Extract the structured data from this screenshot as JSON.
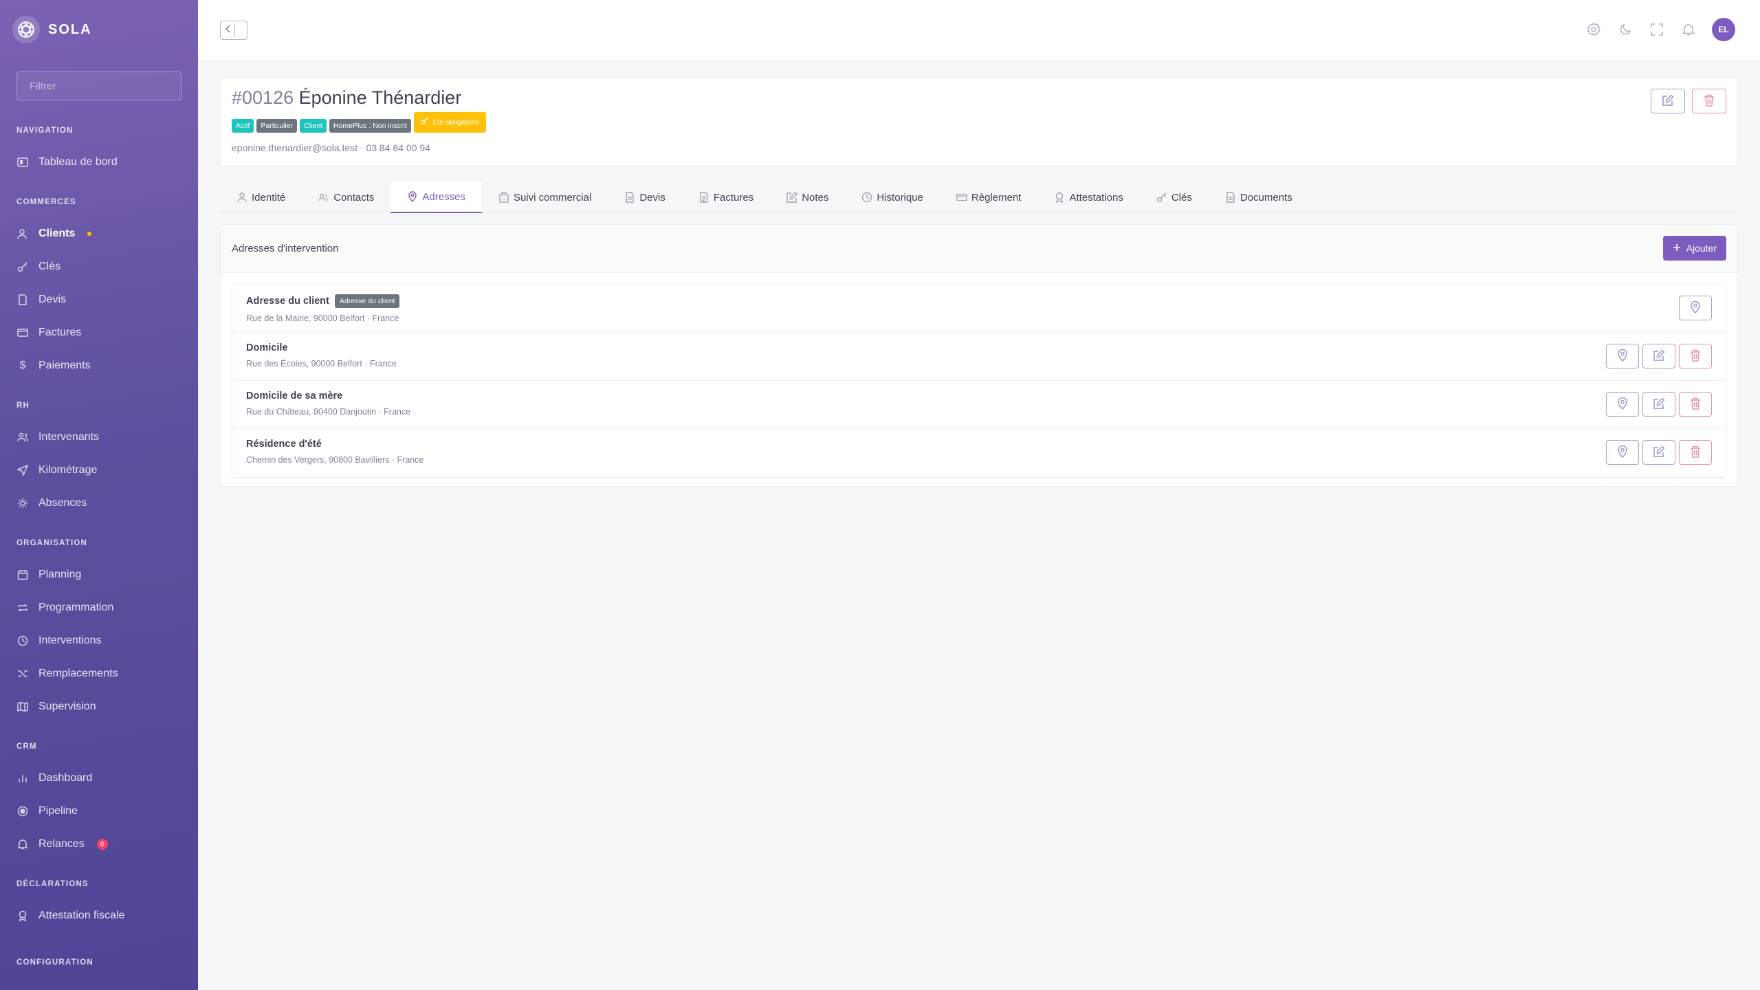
{
  "app": {
    "brand": "SOLA"
  },
  "sidebar": {
    "filter_placeholder": "Filtrer",
    "sections": {
      "navigation": "NAVIGATION",
      "commerces": "COMMERCES",
      "rh": "RH",
      "organisation": "ORGANISATION",
      "crm": "CRM",
      "declarations": "DÉCLARATIONS",
      "configuration": "CONFIGURATION"
    },
    "items": {
      "tableau_de_bord": "Tableau de bord",
      "clients": "Clients",
      "cles": "Clés",
      "devis": "Devis",
      "factures": "Factures",
      "paiements": "Paiements",
      "intervenants": "Intervenants",
      "kilometrage": "Kilométrage",
      "absences": "Absences",
      "planning": "Planning",
      "programmation": "Programmation",
      "interventions": "Interventions",
      "remplacements": "Remplacements",
      "supervision": "Supervision",
      "dashboard": "Dashboard",
      "pipeline": "Pipeline",
      "relances": "Relances",
      "relances_count": "6",
      "attestation_fiscale": "Attestation fiscale"
    }
  },
  "topbar": {
    "avatar_initials": "EL"
  },
  "client": {
    "id": "#00126",
    "name": "Éponine Thénardier",
    "badges": [
      "Actif",
      "Particulier",
      "Client",
      "HomePlus : Non inscrit"
    ],
    "warning_badge": "Clé obligatoire",
    "contact": "eponine.thenardier@sola.test · 03 84 64 00 94"
  },
  "tabs": [
    "Identité",
    "Contacts",
    "Adresses",
    "Suivi commercial",
    "Devis",
    "Factures",
    "Notes",
    "Historique",
    "Règlement",
    "Attestations",
    "Clés",
    "Documents"
  ],
  "active_tab": "Adresses",
  "addresses": {
    "title": "Adresses d'intervention",
    "add_label": "Ajouter",
    "rows": [
      {
        "name": "Adresse du client",
        "tag": "Adresse du client",
        "line": "Rue de la Mairie, 90000 Belfort · France"
      },
      {
        "name": "Domicile",
        "line": "Rue des Écoles, 90000 Belfort · France"
      },
      {
        "name": "Domicile de sa mère",
        "line": "Rue du Château, 90400 Danjoutin · France"
      },
      {
        "name": "Résidence d'été",
        "line": "Chemin des Vergers, 90800 Bavilliers · France"
      }
    ]
  },
  "colors": {
    "accent": "#7c5cbf",
    "teal": "#1bc5bd",
    "warning": "#ffc107",
    "danger": "#f1416c"
  }
}
